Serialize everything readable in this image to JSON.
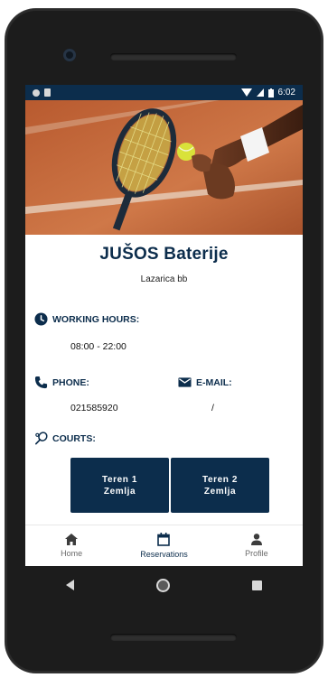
{
  "status": {
    "time": "6:02"
  },
  "venue": {
    "name": "JUŠOS Baterije",
    "address": "Lazarica bb"
  },
  "working_hours": {
    "label": "WORKING HOURS:",
    "value": "08:00 - 22:00"
  },
  "phone": {
    "label": "PHONE:",
    "value": "021585920"
  },
  "email": {
    "label": "E-MAIL:",
    "value": "/"
  },
  "courts": {
    "label": "COURTS:",
    "items": [
      {
        "label": "Teren 1\nZemlja"
      },
      {
        "label": "Teren 2\nZemlja"
      }
    ]
  },
  "nav": {
    "items": [
      {
        "label": "Home",
        "icon": "home-icon"
      },
      {
        "label": "Reservations",
        "icon": "calendar-icon"
      },
      {
        "label": "Profile",
        "icon": "person-icon"
      }
    ]
  },
  "colors": {
    "primary": "#0c2d4c",
    "clay": "#c8693a"
  }
}
